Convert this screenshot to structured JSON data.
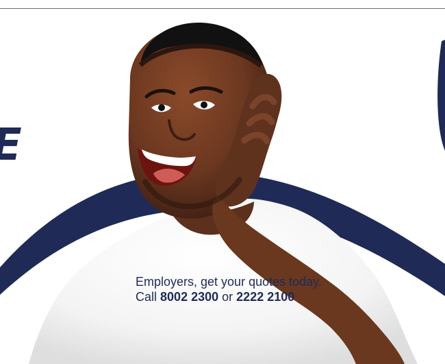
{
  "banner": {
    "headline_fragment": "E",
    "cta": {
      "line1": "Employers, get your quotes today.",
      "line2_prefix": "Call",
      "phone_1": "8002 2300",
      "connector": "or",
      "phone_2": "2222 2100"
    }
  },
  "colors": {
    "navy": "#202a56",
    "text_navy": "#1f2b57",
    "shirt": "#f7f7f7",
    "skin": "#6a3b24",
    "background": "#ffffff"
  }
}
